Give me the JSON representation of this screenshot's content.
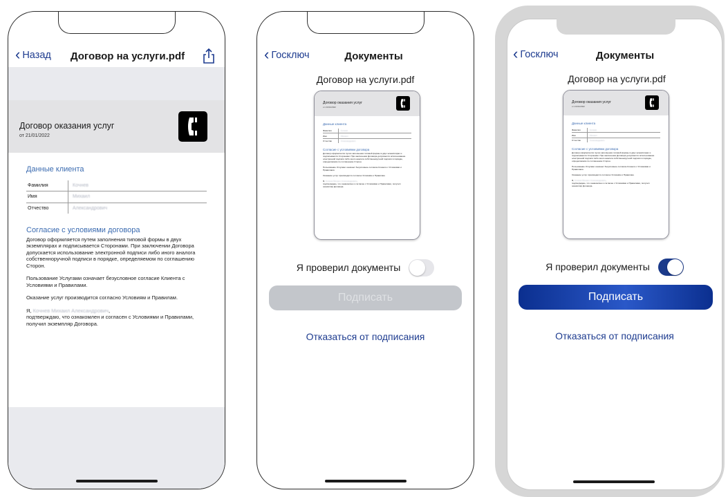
{
  "phone1": {
    "nav": {
      "back_label": "Назад",
      "title": "Договор на услуги.pdf"
    },
    "doc": {
      "title": "Договор оказания услуг",
      "date": "от 21/01/2022",
      "client_section_title": "Данные клиента",
      "fields": [
        {
          "label": "Фамилия",
          "value": "Кочнев"
        },
        {
          "label": "Имя",
          "value": "Михаил"
        },
        {
          "label": "Отчество",
          "value": "Александрович"
        }
      ],
      "agreement_title": "Согласие с условиями договора",
      "p1": "Договор оформляется путем заполнения типовой формы в двух экземплярах и подписывается Сторонами. При заключении Договора допускается использование электронной подписи либо иного аналога собственноручной подписи в порядке, определяемом по соглашению Сторон.",
      "p2": "Пользование Услугами означает безусловное согласие Клиента с Условиями и Правилами.",
      "p3": "Оказание услуг производится согласно Условиям и Правилам.",
      "p4_prefix": "Я,",
      "p4_name": "Кочнев Михаил Александрович",
      "p4_suffix": ",",
      "p4_rest": "подтверждаю, что ознакомлен и согласен с Условиями и Правилами, получил экземпляр Договора."
    }
  },
  "phone2": {
    "nav": {
      "back_label": "Госключ",
      "title": "Документы"
    },
    "file_name": "Договор на услуги.pdf",
    "check_label": "Я проверил документы",
    "toggle_state": "off",
    "sign_label": "Подписать",
    "refuse_label": "Отказаться от подписания"
  },
  "phone3": {
    "nav": {
      "back_label": "Госключ",
      "title": "Документы"
    },
    "file_name": "Договор на услуги.pdf",
    "check_label": "Я проверил документы",
    "toggle_state": "on",
    "sign_label": "Подписать",
    "refuse_label": "Отказаться от подписания"
  },
  "colors": {
    "accent": "#1b3a8a",
    "link": "#1d3b8f",
    "section_title": "#3b6bb0",
    "disabled_button": "#c3c6cb"
  }
}
